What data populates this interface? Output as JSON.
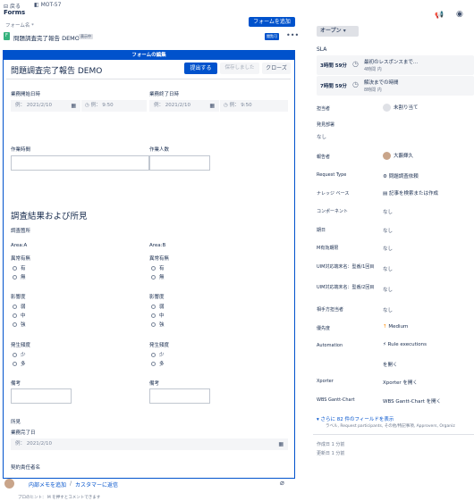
{
  "topbar": {
    "back": "戻る",
    "issue_key": "MOT-57"
  },
  "forms": {
    "title": "Forms",
    "form_name_label": "フォーム名 *",
    "add_button": "フォームを追加",
    "row_name": "問題調査完了報告 DEMO",
    "row_badge": "表示中",
    "row_badge2": "閲覧可"
  },
  "editor": {
    "header": "フォームの編集",
    "title": "問題調査完了報告 DEMO",
    "submit": "提出する",
    "saved": "保存しました",
    "close": "クローズ",
    "start_date_label": "業務開始日時",
    "end_date_label": "業務終了日時",
    "date_placeholder": "例： 2021/2/10",
    "time_placeholder": "例： 9:50",
    "work_time_label": "作業時間",
    "worker_count_label": "作業人数",
    "section_heading": "調査結果および所見",
    "survey_place": "調査箇所",
    "area_a": "Area:A",
    "area_b": "Area:B",
    "abnormal_label": "異常有無",
    "abnormal_opts": [
      "有",
      "無"
    ],
    "impact_label": "影響度",
    "impact_opts": [
      "弱",
      "中",
      "強"
    ],
    "freq_label": "発生頻度",
    "freq_opts": [
      "少",
      "多"
    ],
    "note_label": "備考",
    "findings": "所見",
    "complete_date_label": "業務完了日",
    "contract_label": "契約責任者名"
  },
  "bottom": {
    "internal_note": "内部メモを追加",
    "reply": "カスタマーに返信",
    "hint": "プロのヒント： M を押すとコメントできます"
  },
  "right": {
    "status": "オープン",
    "sla": "SLA",
    "sla1_time": "3時間 59分",
    "sla1_title": "最初のレスポンスまで...",
    "sla1_sub": "4時間 内",
    "sla2_time": "7時間 59分",
    "sla2_title": "解決までの時間",
    "sla2_sub": "8時間 内",
    "assignee_label": "担当者",
    "assignee_value": "未割り当て",
    "found_by_label": "発見部署",
    "found_by_value": "なし",
    "reporter_label": "報告者",
    "reporter_value": "大藪輝久",
    "request_type_label": "Request Type",
    "request_type_value": "問題調査依頼",
    "kb_label": "ナレッジ ベース",
    "kb_value": "記事を検索または作成",
    "component_label": "コンポーネント",
    "component_value": "なし",
    "deadline_label": "期日",
    "deadline_value": "なし",
    "m_label": "M有効期限",
    "m_value": "なし",
    "uim1_label": "UIM対応端末名：型番/1回目",
    "uim1_value": "なし",
    "uim2_label": "UIM対応端末名：型番/2回目",
    "uim2_value": "なし",
    "partner_label": "相手方担当者",
    "partner_value": "なし",
    "priority_label": "優先度",
    "priority_value": "Medium",
    "automation_label": "Automation",
    "automation_value": "Rule executions",
    "open_link": "を開く",
    "xporter_label": "Xporter",
    "xporter_value": "Xporter を開く",
    "wbs_label": "WBS Gantt-Chart",
    "wbs_value": "WBS Gantt-Chart を開く",
    "more_fields": "さらに 82 件のフィールドを表示",
    "more_fields_sub": "ラベル, Request participants, その他/特記事項, Approvers, Organiz",
    "created": "作成日 1 分前",
    "updated": "更新日 1 分前"
  },
  "colors": {
    "accent": "#0052cc",
    "priority": "#ff8b00"
  }
}
